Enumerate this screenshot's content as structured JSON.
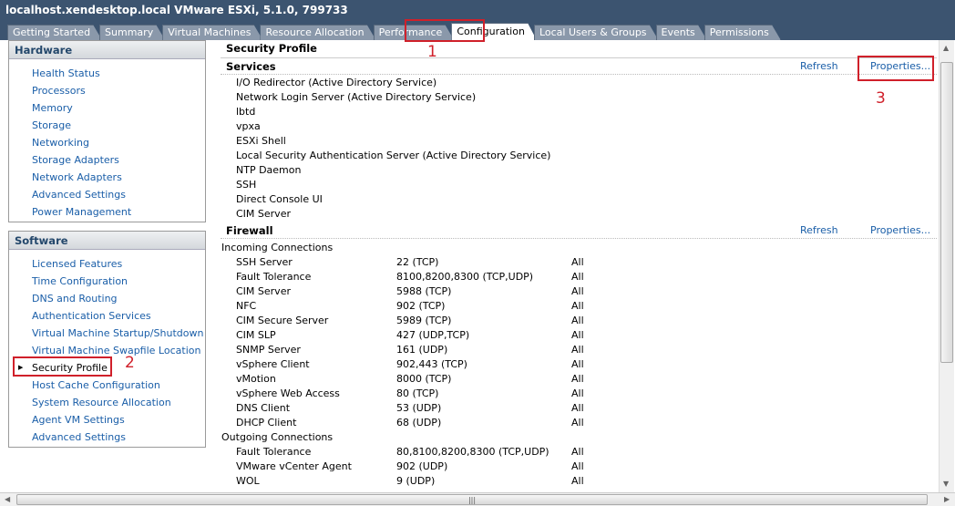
{
  "window": {
    "title": "localhost.xendesktop.local VMware ESXi, 5.1.0, 799733"
  },
  "tabs": [
    {
      "label": "Getting Started"
    },
    {
      "label": "Summary"
    },
    {
      "label": "Virtual Machines"
    },
    {
      "label": "Resource Allocation"
    },
    {
      "label": "Performance"
    },
    {
      "label": "Configuration",
      "active": true
    },
    {
      "label": "Local Users & Groups"
    },
    {
      "label": "Events"
    },
    {
      "label": "Permissions"
    }
  ],
  "hardware": {
    "title": "Hardware",
    "items": [
      "Health Status",
      "Processors",
      "Memory",
      "Storage",
      "Networking",
      "Storage Adapters",
      "Network Adapters",
      "Advanced Settings",
      "Power Management"
    ]
  },
  "software": {
    "title": "Software",
    "items": [
      "Licensed Features",
      "Time Configuration",
      "DNS and Routing",
      "Authentication Services",
      "Virtual Machine Startup/Shutdown",
      "Virtual Machine Swapfile Location",
      "Security Profile",
      "Host Cache Configuration",
      "System Resource Allocation",
      "Agent VM Settings",
      "Advanced Settings"
    ],
    "selected": 6
  },
  "main": {
    "title": "Security Profile",
    "services": {
      "title": "Services",
      "refresh": "Refresh",
      "properties": "Properties...",
      "items": [
        "I/O Redirector (Active Directory Service)",
        "Network Login Server (Active Directory Service)",
        "lbtd",
        "vpxa",
        "ESXi Shell",
        "Local Security Authentication Server (Active Directory Service)",
        "NTP Daemon",
        "SSH",
        "Direct Console UI",
        "CIM Server"
      ]
    },
    "firewall": {
      "title": "Firewall",
      "refresh": "Refresh",
      "properties": "Properties...",
      "incoming_label": "Incoming Connections",
      "incoming": [
        [
          "SSH Server",
          "22 (TCP)",
          "All"
        ],
        [
          "Fault Tolerance",
          "8100,8200,8300 (TCP,UDP)",
          "All"
        ],
        [
          "CIM Server",
          "5988 (TCP)",
          "All"
        ],
        [
          "NFC",
          "902 (TCP)",
          "All"
        ],
        [
          "CIM Secure Server",
          "5989 (TCP)",
          "All"
        ],
        [
          "CIM SLP",
          "427 (UDP,TCP)",
          "All"
        ],
        [
          "SNMP Server",
          "161 (UDP)",
          "All"
        ],
        [
          "vSphere Client",
          "902,443 (TCP)",
          "All"
        ],
        [
          "vMotion",
          "8000 (TCP)",
          "All"
        ],
        [
          "vSphere Web Access",
          "80 (TCP)",
          "All"
        ],
        [
          "DNS Client",
          "53 (UDP)",
          "All"
        ],
        [
          "DHCP Client",
          "68 (UDP)",
          "All"
        ]
      ],
      "outgoing_label": "Outgoing Connections",
      "outgoing": [
        [
          "Fault Tolerance",
          "80,8100,8200,8300 (TCP,UDP)",
          "All"
        ],
        [
          "VMware vCenter Agent",
          "902 (UDP)",
          "All"
        ],
        [
          "WOL",
          "9 (UDP)",
          "All"
        ]
      ]
    }
  },
  "annotations": [
    "1",
    "2",
    "3"
  ],
  "colors": {
    "titlebar": "#3c5470",
    "link": "#1a5ea8",
    "annotation": "#d0202a"
  }
}
